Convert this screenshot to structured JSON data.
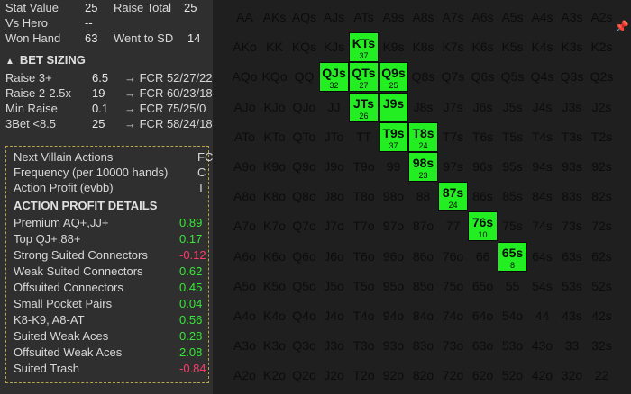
{
  "stats": [
    {
      "label": "Stat Value",
      "value": "25",
      "label2": "Raise Total",
      "value2": "25"
    },
    {
      "label": "Vs Hero",
      "value": "--",
      "label2": "",
      "value2": ""
    },
    {
      "label": "Won Hand",
      "value": "63",
      "label2": "Went to SD",
      "value2": "14"
    }
  ],
  "bet_sizing": {
    "title": "BET SIZING",
    "rows": [
      {
        "label": "Raise 3+",
        "value": "6.5",
        "fcr": "→ FCR 52/27/22"
      },
      {
        "label": "Raise 2-2.5x",
        "value": "19",
        "fcr": "→ FCR 60/23/18"
      },
      {
        "label": "Min Raise",
        "value": "0.1",
        "fcr": "→ FCR 75/25/0"
      },
      {
        "label": "3Bet <8.5",
        "value": "25",
        "fcr": "→ FCR 58/24/18"
      }
    ]
  },
  "villain": {
    "next_label": "Next Villain Actions",
    "next_value": "FC",
    "freq_label": "Frequency (per 10000 hands)",
    "freq_value": "C",
    "profit_label": "Action Profit (evbb)",
    "profit_value": "T"
  },
  "profit_details": {
    "title": "ACTION PROFIT DETAILS",
    "rows": [
      {
        "label": "Premium AQ+,JJ+",
        "value": "0.89",
        "sign": "pos"
      },
      {
        "label": "Top QJ+,88+",
        "value": "0.17",
        "sign": "pos"
      },
      {
        "label": "Strong Suited Connectors",
        "value": "-0.12",
        "sign": "neg"
      },
      {
        "label": "Weak Suited Connectors",
        "value": "0.62",
        "sign": "pos"
      },
      {
        "label": "Offsuited Connectors",
        "value": "0.45",
        "sign": "pos"
      },
      {
        "label": "Small Pocket Pairs",
        "value": "0.04",
        "sign": "pos"
      },
      {
        "label": "K8-K9, A8-AT",
        "value": "0.56",
        "sign": "pos"
      },
      {
        "label": "Suited Weak Aces",
        "value": "0.28",
        "sign": "pos"
      },
      {
        "label": "Offsuited Weak Aces",
        "value": "2.08",
        "sign": "pos"
      },
      {
        "label": "Suited Trash",
        "value": "-0.84",
        "sign": "neg"
      }
    ]
  },
  "matrix": {
    "ranks": [
      "A",
      "K",
      "Q",
      "J",
      "T",
      "9",
      "8",
      "7",
      "6",
      "5",
      "4",
      "3",
      "2"
    ],
    "highlights": {
      "KTs": "37",
      "QJs": "32",
      "QTs": "27",
      "Q9s": "25",
      "JTs": "26",
      "J9s": "",
      "T9s": "37",
      "T8s": "24",
      "98s": "23",
      "87s": "24",
      "76s": "10",
      "65s": "8"
    }
  },
  "colors": {
    "positive": "#39e639",
    "negative": "#ff3b6b",
    "highlight": "#22ee22"
  },
  "icons": {
    "pin": "pin-icon",
    "collapse": "triangle-up-icon"
  }
}
